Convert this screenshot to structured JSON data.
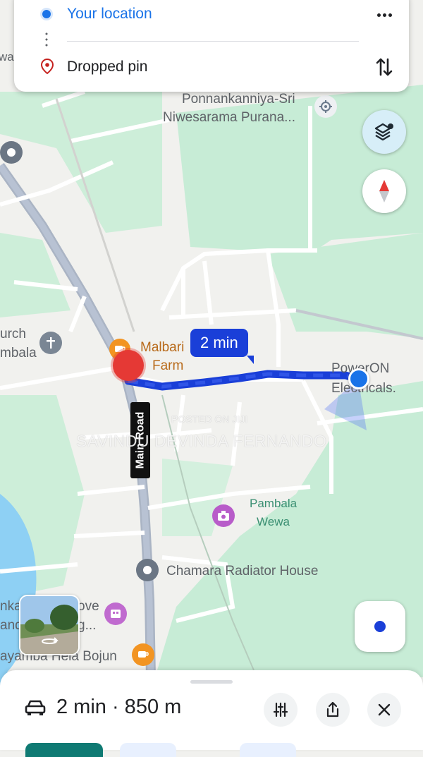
{
  "route_card": {
    "origin": "Your location",
    "destination": "Dropped pin"
  },
  "route_badge": "2 min",
  "map_labels": {
    "ponnankanniya_line1": "Ponnankanniya-Sri",
    "ponnankanniya_line2": "Niwesarama Purana...",
    "church_line1": "urch",
    "church_line2": "mbala",
    "malbari_line1": "Malbari",
    "malbari_line2": "Farm",
    "poweron_line1": "PowerON",
    "poweron_line2": "Electricals.",
    "main_road": "Main Road",
    "pambala_line1": "Pambala",
    "pambala_line2": "Wewa",
    "chamara": "Chamara Radiator House",
    "edge_wa": "wa",
    "grove_line1": "nka",
    "grove_line1b": "ove",
    "grove_line2": "and",
    "grove_line2b": "g...",
    "hela_bojun": "ayamba Hela Bojun"
  },
  "watermark": {
    "posted": "POSTED ON JIJI",
    "author": "SAVINDU DEVINDA FERNANDO"
  },
  "bottom_bar": {
    "summary": "2 min · 850 m"
  },
  "colors": {
    "route": "#1a3fd8",
    "accent_blue": "#1a73e8",
    "pin_red": "#ea4335",
    "map_green": "#c7ecd6",
    "water": "#8ed0f4"
  }
}
